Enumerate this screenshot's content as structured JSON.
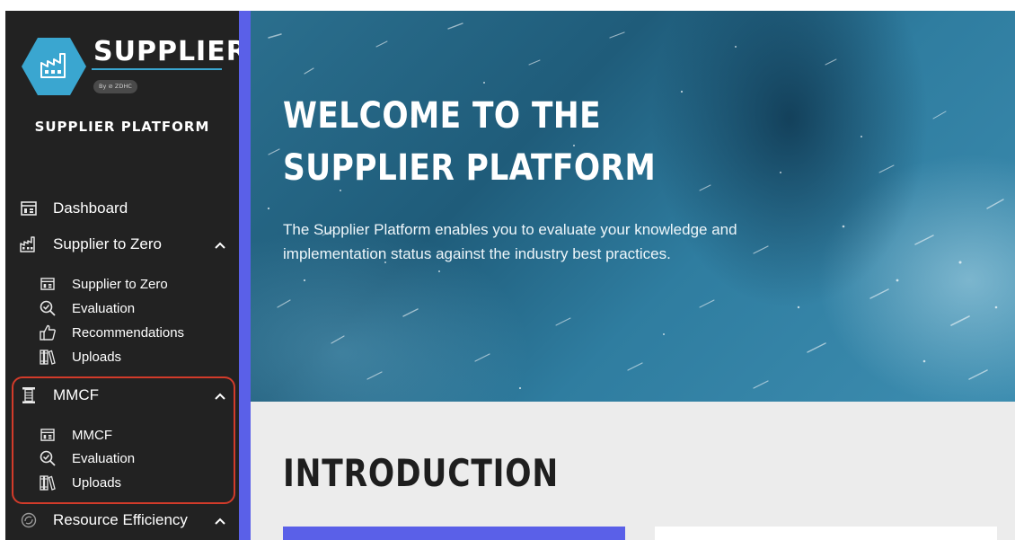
{
  "brand": {
    "name": "SUPPLIER",
    "by": "By ⊘ ZDHC",
    "platform": "SUPPLIER PLATFORM"
  },
  "nav": {
    "dashboard": "Dashboard",
    "supplier_to_zero": {
      "label": "Supplier to Zero",
      "items": [
        "Supplier to Zero",
        "Evaluation",
        "Recommendations",
        "Uploads"
      ]
    },
    "mmcf": {
      "label": "MMCF",
      "items": [
        "MMCF",
        "Evaluation",
        "Uploads"
      ]
    },
    "resource_efficiency": "Resource Efficiency"
  },
  "hero": {
    "title": "WELCOME TO THE SUPPLIER PLATFORM",
    "text": "The Supplier Platform enables you to evaluate your knowledge and implementation status against the industry best practices."
  },
  "intro": {
    "title": "INTRODUCTION"
  },
  "colors": {
    "sidebar_bg": "#222222",
    "accent": "#5a60e8",
    "brand_blue": "#3aa6d0",
    "highlight": "#d23b2a"
  }
}
